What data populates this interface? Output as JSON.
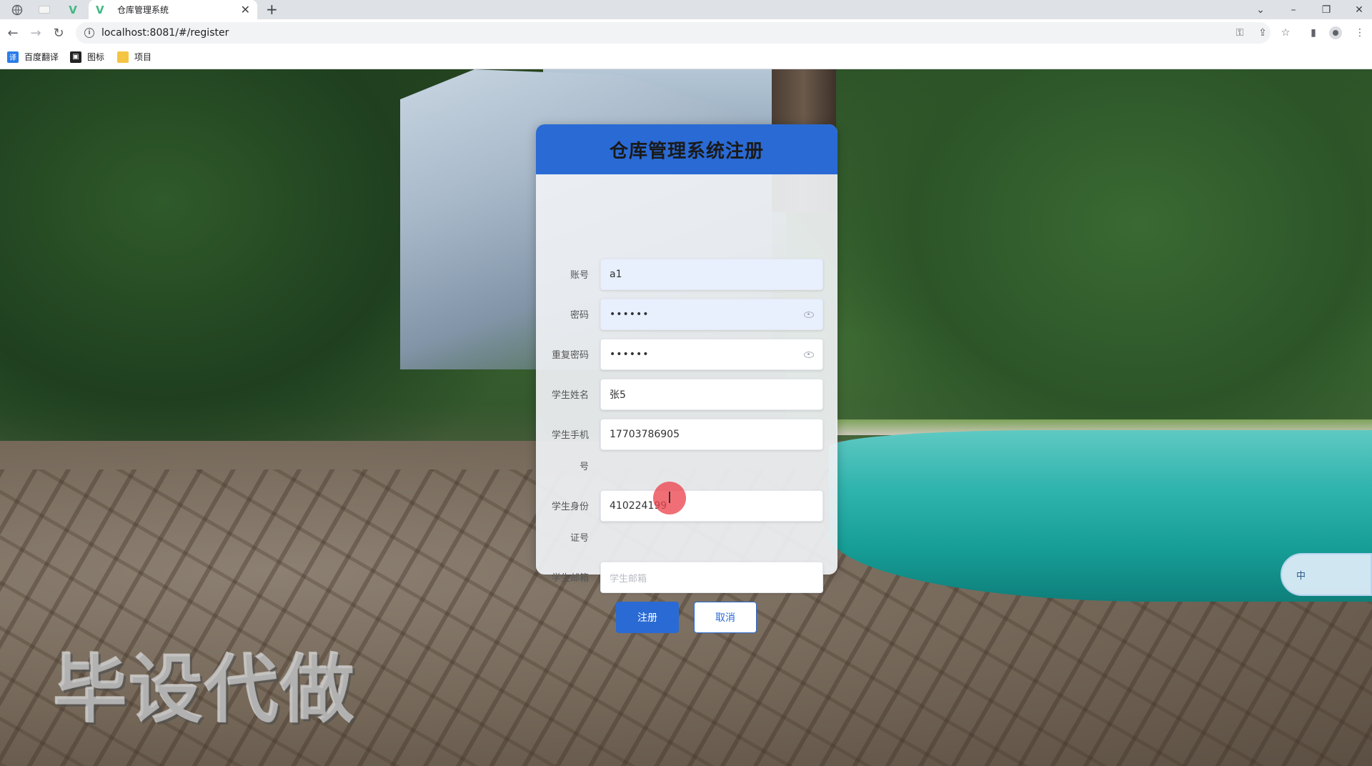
{
  "browser": {
    "tab_title": "仓库管理系统",
    "url": "localhost:8081/#/register",
    "bookmarks": [
      {
        "label": "百度翻译"
      },
      {
        "label": "图标"
      },
      {
        "label": "项目"
      }
    ]
  },
  "form": {
    "title": "仓库管理系统注册",
    "fields": [
      {
        "label": "账号",
        "value": "a1"
      },
      {
        "label": "密码",
        "value": "••••••"
      },
      {
        "label": "重复密码",
        "value": "••••••"
      },
      {
        "label": "学生姓名",
        "value": "张5"
      },
      {
        "label_line1": "学生手机",
        "label_line2": "号",
        "value": "17703786905"
      },
      {
        "label_line1": "学生身份",
        "label_line2": "证号",
        "value": "410224199"
      },
      {
        "label": "学生邮箱",
        "placeholder": "学生邮箱"
      }
    ],
    "submit_label": "注册",
    "cancel_label": "取消"
  },
  "ime": {
    "mode": "中"
  },
  "watermark": "毕设代做",
  "colors": {
    "primary": "#2a6ad4",
    "tab_bar": "#dee1e6"
  }
}
